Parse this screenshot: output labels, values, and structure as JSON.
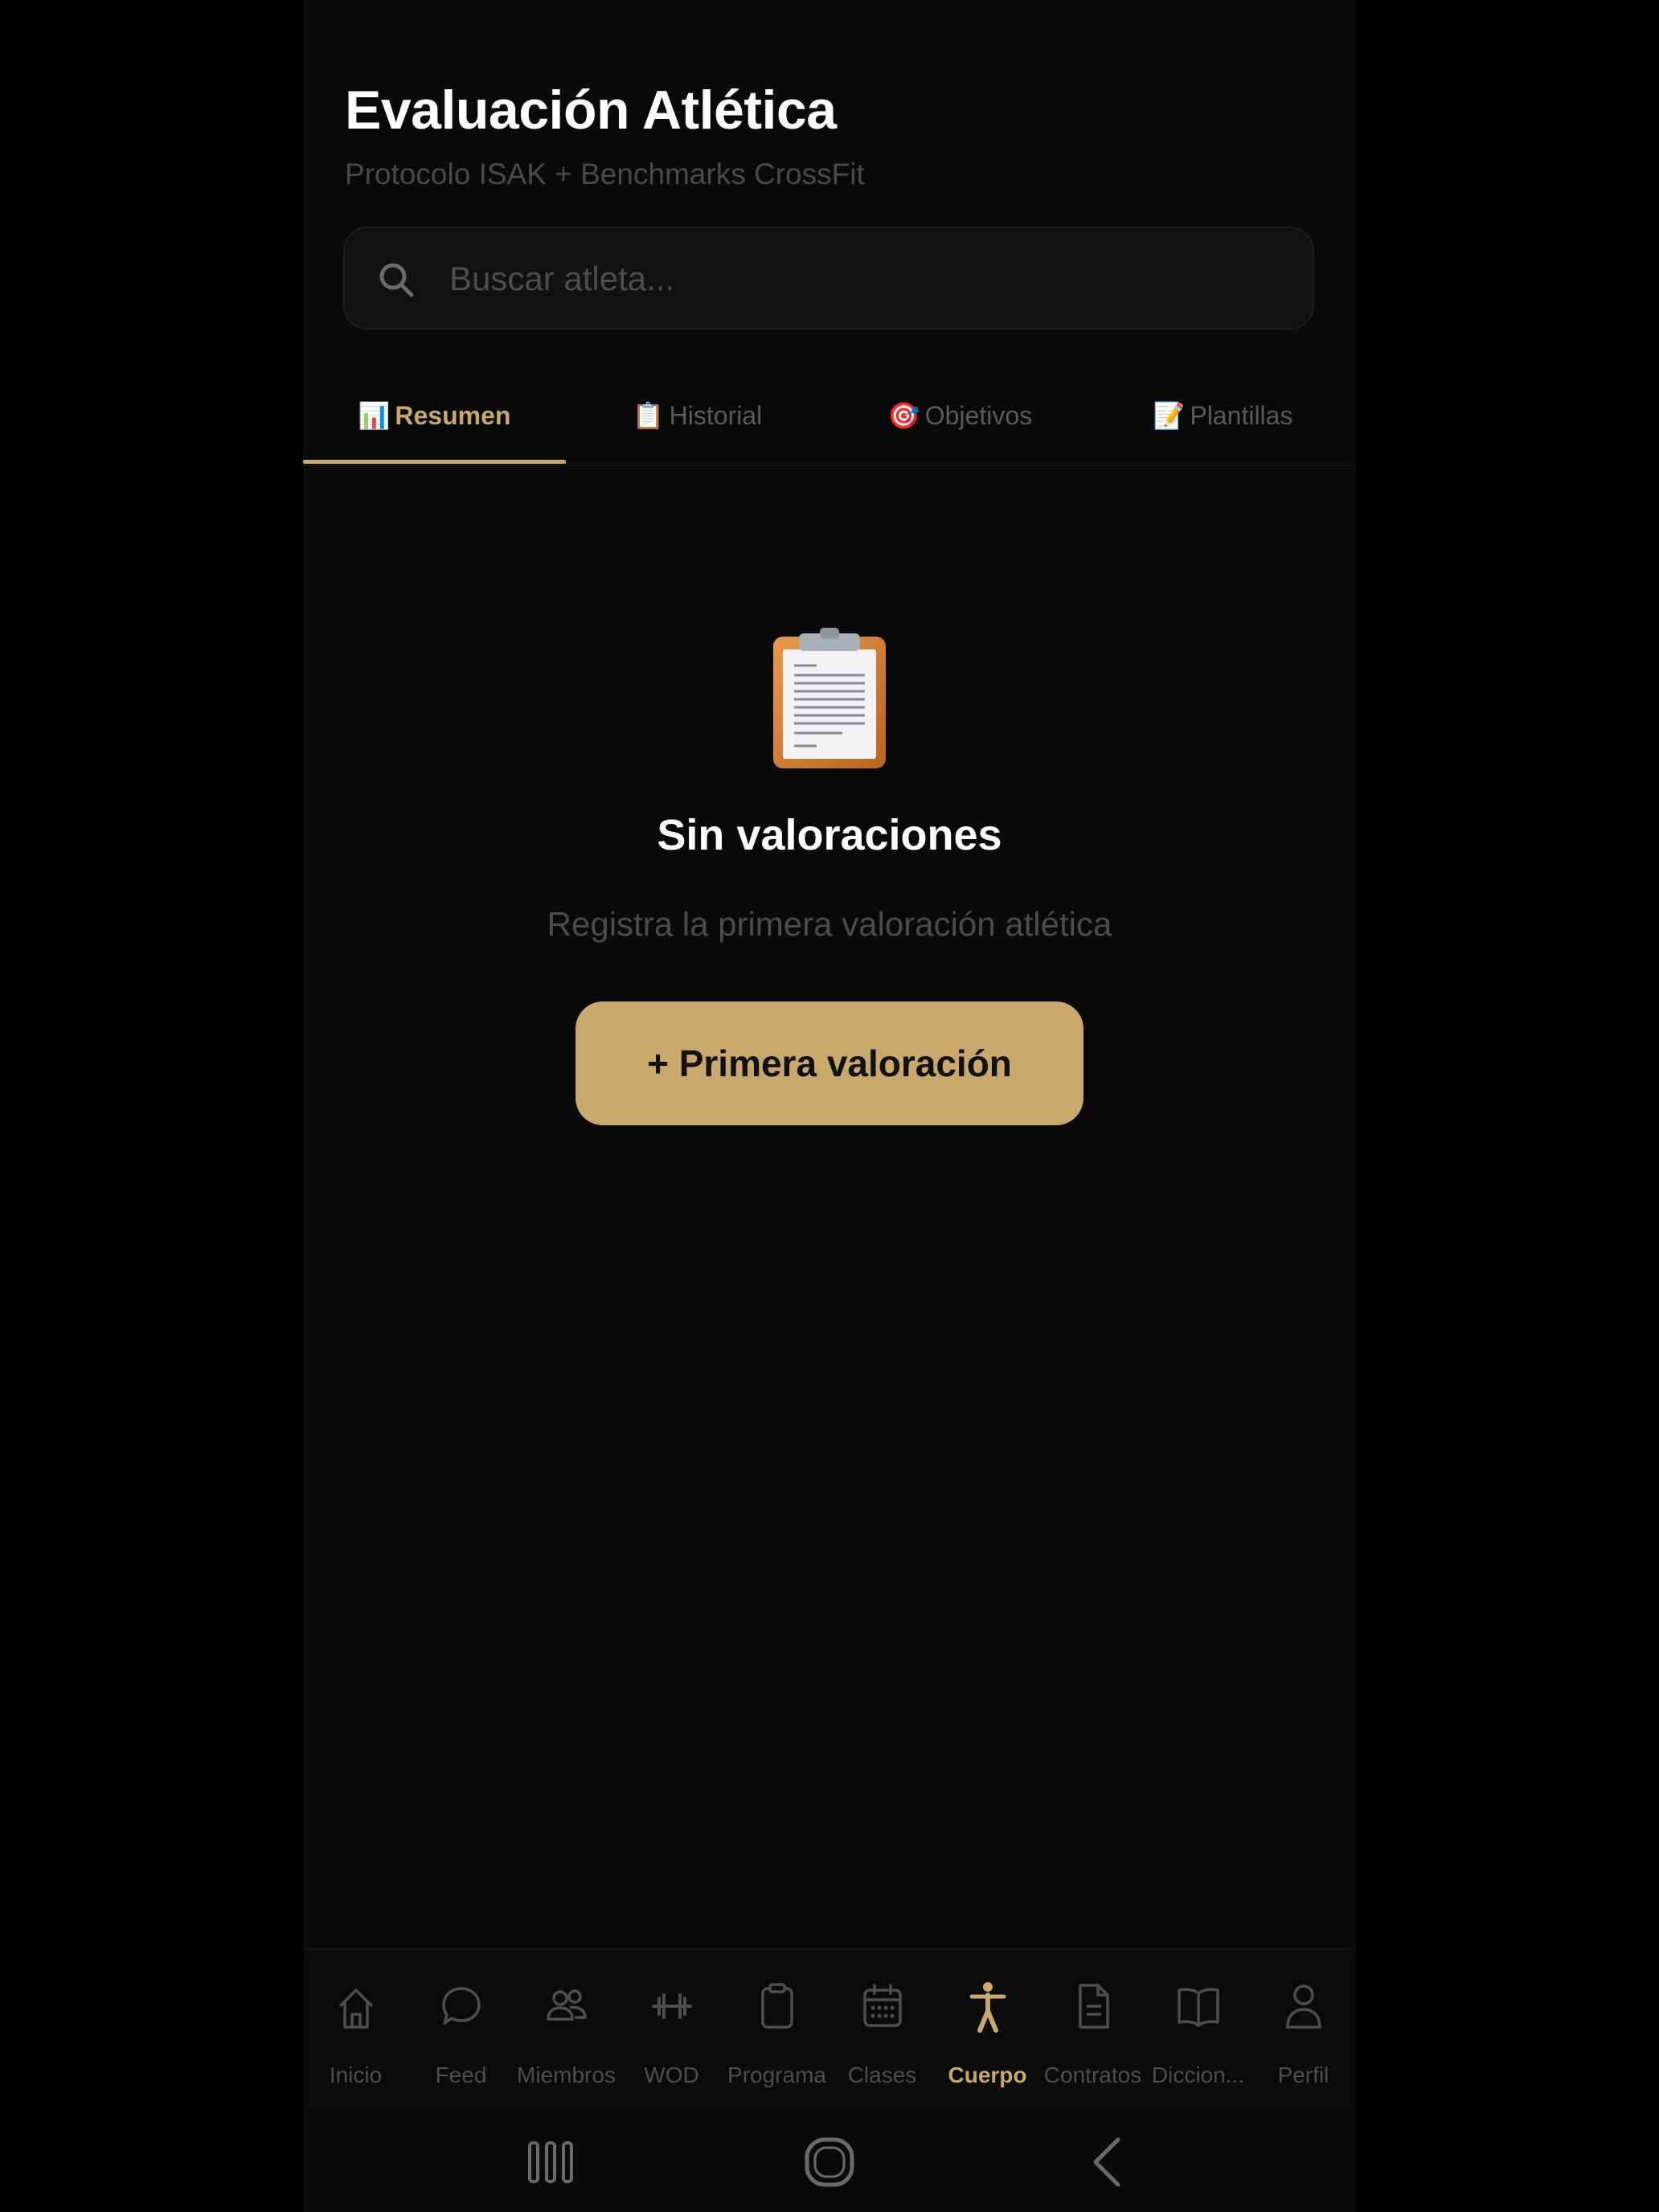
{
  "header": {
    "title": "Evaluación Atlética",
    "subtitle": "Protocolo ISAK + Benchmarks CrossFit"
  },
  "search": {
    "placeholder": "Buscar atleta...",
    "value": ""
  },
  "tabs": [
    {
      "icon": "📊",
      "label": "Resumen",
      "active": true
    },
    {
      "icon": "📋",
      "label": "Historial",
      "active": false
    },
    {
      "icon": "🎯",
      "label": "Objetivos",
      "active": false
    },
    {
      "icon": "📝",
      "label": "Plantillas",
      "active": false
    }
  ],
  "empty_state": {
    "icon": "clipboard-icon",
    "title": "Sin valoraciones",
    "description": "Registra la primera valoración atlética",
    "button_label": "+ Primera valoración"
  },
  "bottom_nav": [
    {
      "label": "Inicio",
      "icon": "home-icon"
    },
    {
      "label": "Feed",
      "icon": "chat-icon"
    },
    {
      "label": "Miembros",
      "icon": "users-icon"
    },
    {
      "label": "WOD",
      "icon": "dumbbell-icon"
    },
    {
      "label": "Programa",
      "icon": "clipboard-icon"
    },
    {
      "label": "Clases",
      "icon": "calendar-icon"
    },
    {
      "label": "Cuerpo",
      "icon": "body-icon",
      "active": true
    },
    {
      "label": "Contratos",
      "icon": "document-icon"
    },
    {
      "label": "Diccion...",
      "icon": "book-icon"
    },
    {
      "label": "Perfil",
      "icon": "user-icon"
    }
  ],
  "colors": {
    "accent": "#c9a86c",
    "background": "#0a0a0a",
    "text_primary": "#ffffff",
    "text_muted": "#4e4e4e"
  }
}
